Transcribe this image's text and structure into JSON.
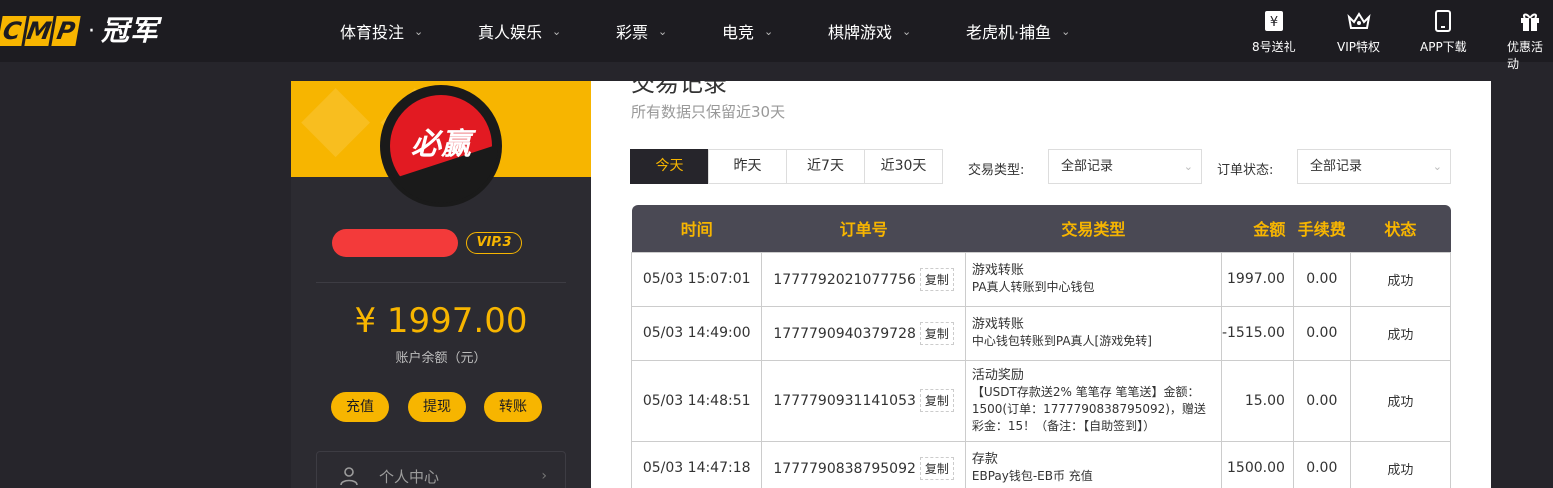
{
  "header": {
    "logo_letters": [
      "C",
      "M",
      "P"
    ],
    "logo_dot": "·",
    "logo_text": "冠军",
    "nav": [
      {
        "label": "体育投注"
      },
      {
        "label": "真人娱乐"
      },
      {
        "label": "彩票"
      },
      {
        "label": "电竞"
      },
      {
        "label": "棋牌游戏"
      },
      {
        "label": "老虎机·捕鱼"
      }
    ],
    "quick": [
      {
        "label": "8号送礼",
        "icon": "gift-ticket-icon"
      },
      {
        "label": "VIP特权",
        "icon": "crown-icon"
      },
      {
        "label": "APP下载",
        "icon": "phone-icon"
      },
      {
        "label": "优惠活动",
        "icon": "gift-box-icon"
      }
    ]
  },
  "sidebar": {
    "avatar_text": "必赢",
    "vip": "VIP.3",
    "balance": "¥ 1997.00",
    "balance_label": "账户余额（元）",
    "buttons": {
      "deposit": "充值",
      "withdraw": "提现",
      "transfer": "转账"
    },
    "menu_personal": "个人中心"
  },
  "main": {
    "title": "交易记录",
    "subtitle": "所有数据只保留近30天",
    "tabs": [
      "今天",
      "昨天",
      "近7天",
      "近30天"
    ],
    "filter_type_label": "交易类型:",
    "filter_type_value": "全部记录",
    "filter_status_label": "订单状态:",
    "filter_status_value": "全部记录",
    "columns": [
      "时间",
      "订单号",
      "交易类型",
      "金额",
      "手续费",
      "状态"
    ],
    "copy_label": "复制",
    "rows": [
      {
        "time": "05/03 15:07:01",
        "order": "1777792021077756",
        "type": "游戏转账",
        "desc": "PA真人转账到中心钱包",
        "amount": "1997.00",
        "fee": "0.00",
        "status": "成功"
      },
      {
        "time": "05/03 14:49:00",
        "order": "1777790940379728",
        "type": "游戏转账",
        "desc": "中心钱包转账到PA真人[游戏免转]",
        "amount": "-1515.00",
        "fee": "0.00",
        "status": "成功"
      },
      {
        "time": "05/03 14:48:51",
        "order": "1777790931141053",
        "type": "活动奖励",
        "desc": "【USDT存款送2% 笔笔存 笔笔送】金额：1500(订单：1777790838795092)，赠送彩金：15！（备注：【自助签到】）",
        "amount": "15.00",
        "fee": "0.00",
        "status": "成功"
      },
      {
        "time": "05/03 14:47:18",
        "order": "1777790838795092",
        "type": "存款",
        "desc": "EBPay钱包-EB币 充值",
        "amount": "1500.00",
        "fee": "0.00",
        "status": "成功"
      }
    ]
  }
}
